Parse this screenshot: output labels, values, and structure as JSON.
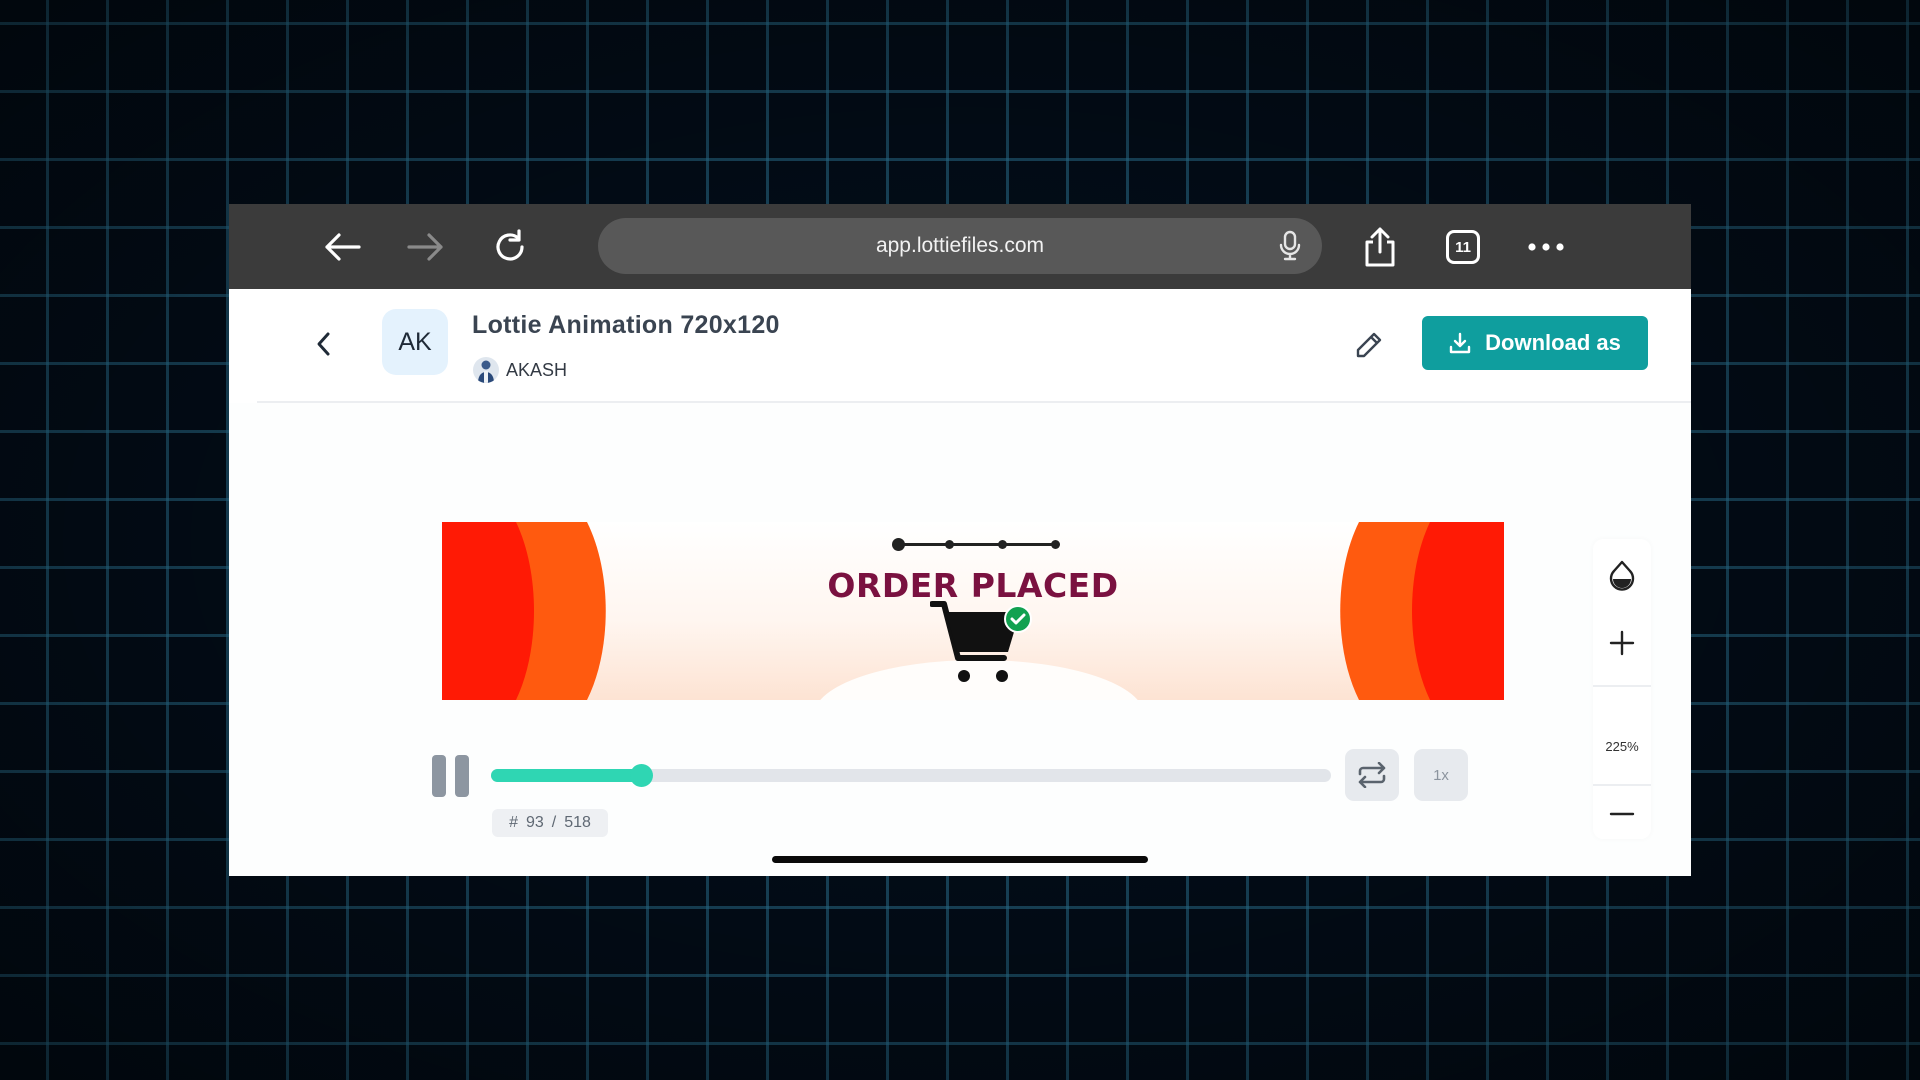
{
  "browser": {
    "url": "app.lottiefiles.com",
    "tab_count": "11"
  },
  "header": {
    "avatar_initials": "AK",
    "title": "Lottie Animation 720x120",
    "author": "AKASH",
    "download_label": "Download as"
  },
  "animation": {
    "headline": "ORDER PLACED",
    "colors": {
      "red": "#ff1a05",
      "orange": "#ff5a0f",
      "headline": "#7a1140",
      "check": "#12a150"
    }
  },
  "zoom": {
    "value": "225%"
  },
  "player": {
    "progress": 0.18,
    "frame_hash": "#",
    "frame_current": "93",
    "frame_sep": "/",
    "frame_total": "518",
    "speed": "1x",
    "accent": "#2fd6b3"
  },
  "icons": [
    "back-arrow-icon",
    "forward-arrow-icon",
    "reload-icon",
    "microphone-icon",
    "share-icon",
    "tabs-icon",
    "more-icon",
    "chevron-left-icon",
    "pencil-icon",
    "download-icon",
    "color-drop-icon",
    "zoom-in-icon",
    "zoom-out-icon",
    "pause-icon",
    "loop-icon",
    "shopping-cart-icon",
    "checkmark-icon"
  ]
}
